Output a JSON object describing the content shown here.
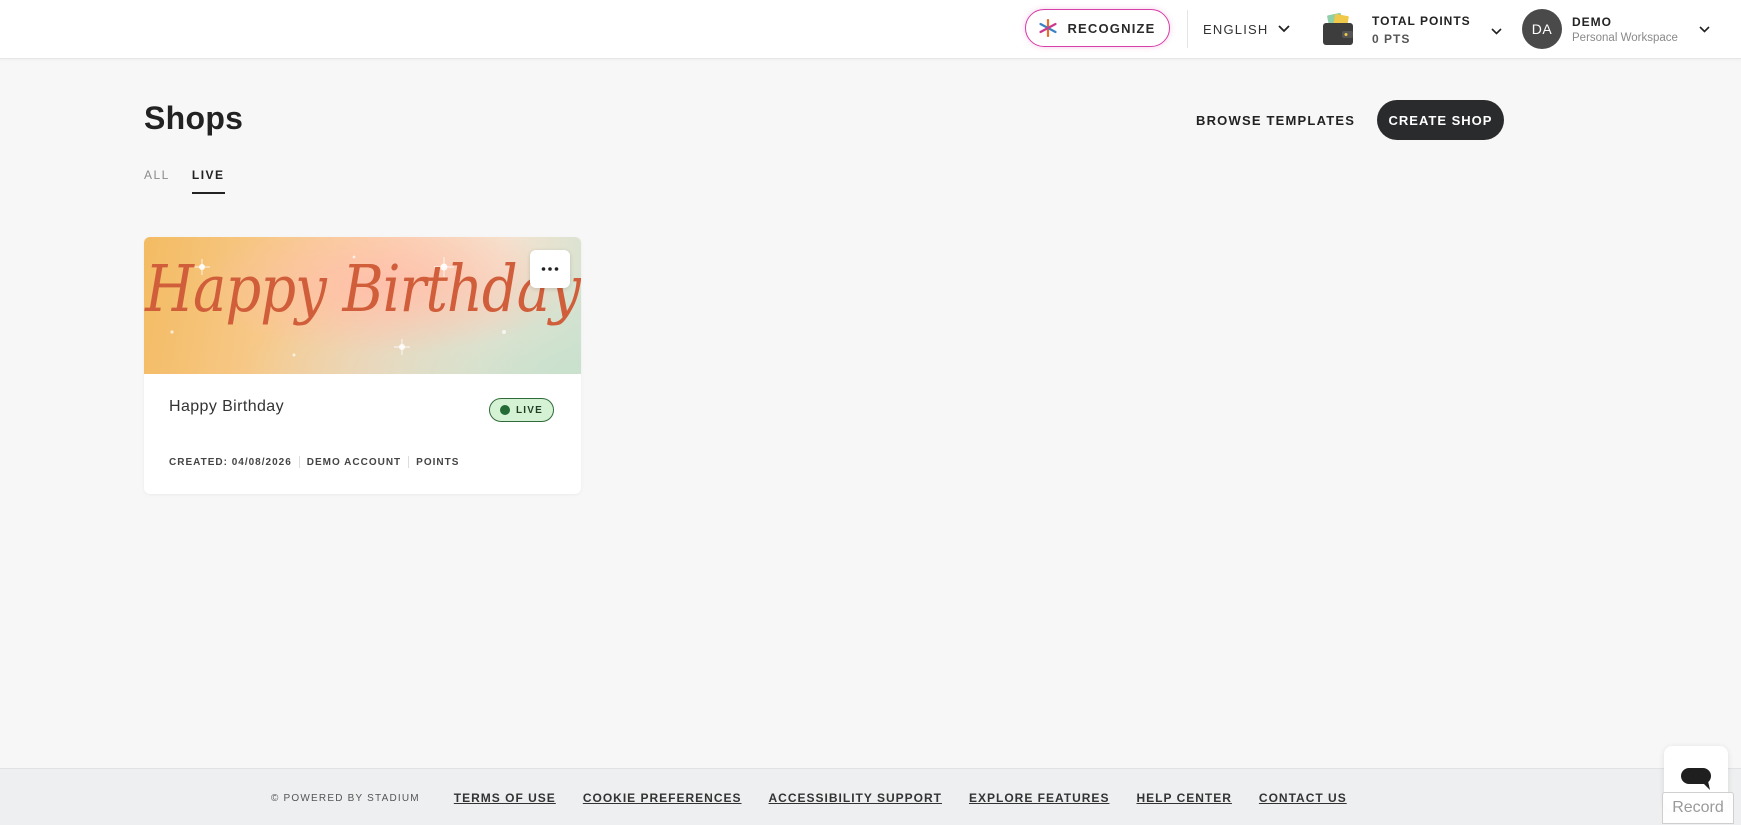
{
  "header": {
    "recognize_label": "RECOGNIZE",
    "language_label": "ENGLISH",
    "points_label": "TOTAL POINTS",
    "points_value": "0 PTS",
    "user_initials": "DA",
    "user_name": "DEMO",
    "user_workspace": "Personal Workspace"
  },
  "page": {
    "title": "Shops",
    "browse_label": "BROWSE TEMPLATES",
    "create_label": "CREATE SHOP",
    "tabs": [
      {
        "label": "ALL",
        "active": false
      },
      {
        "label": "LIVE",
        "active": true
      }
    ]
  },
  "shops": [
    {
      "banner_text": "Happy Birthday",
      "title": "Happy Birthday",
      "status": "LIVE",
      "created": "CREATED: 04/08/2026",
      "account": "DEMO ACCOUNT",
      "currency": "POINTS"
    }
  ],
  "footer": {
    "powered": "© POWERED BY STADIUM",
    "links": [
      "TERMS OF USE",
      "COOKIE PREFERENCES",
      "ACCESSIBILITY SUPPORT",
      "EXPLORE FEATURES",
      "HELP CENTER",
      "CONTACT US"
    ]
  },
  "widgets": {
    "record_label": "Record"
  },
  "colors": {
    "primary_button": "#2a2b2d",
    "recognize_border": "#d63fa7",
    "live_badge_bg": "#d6f2d4",
    "live_dot": "#236a34",
    "banner_text": "#d15e3b"
  },
  "icons": {
    "recognize": "asterisk-icon",
    "language": "chevron-down-icon",
    "points": "wallet-icon",
    "more": "ellipsis-icon",
    "chat": "chat-bubble-icon"
  }
}
